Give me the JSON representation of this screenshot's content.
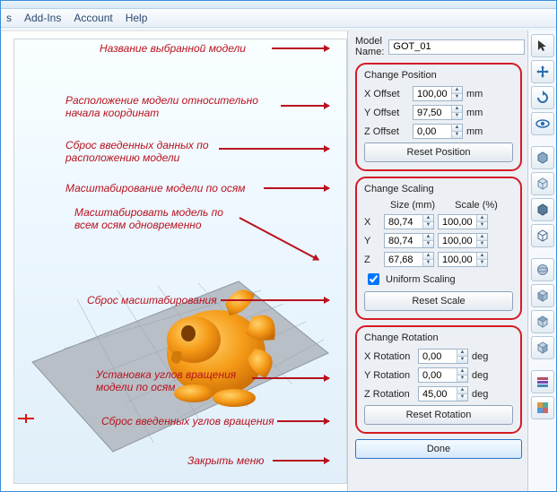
{
  "menu": {
    "items": [
      "Add-Ins",
      "Account",
      "Help"
    ],
    "prefix": "s"
  },
  "model_name": {
    "label": "Model Name:",
    "value": "GOT_01"
  },
  "position": {
    "title": "Change Position",
    "x": {
      "label": "X Offset",
      "value": "100,00",
      "unit": "mm"
    },
    "y": {
      "label": "Y Offset",
      "value": "97,50",
      "unit": "mm"
    },
    "z": {
      "label": "Z Offset",
      "value": "0,00",
      "unit": "mm"
    },
    "reset": "Reset Position"
  },
  "scaling": {
    "title": "Change Scaling",
    "size_hdr": "Size (mm)",
    "scale_hdr": "Scale (%)",
    "x": {
      "ax": "X",
      "size": "80,74",
      "scale": "100,00"
    },
    "y": {
      "ax": "Y",
      "size": "80,74",
      "scale": "100,00"
    },
    "z": {
      "ax": "Z",
      "size": "67,68",
      "scale": "100,00"
    },
    "uniform": {
      "checked": true,
      "label": "Uniform Scaling"
    },
    "reset": "Reset Scale"
  },
  "rotation": {
    "title": "Change Rotation",
    "x": {
      "label": "X Rotation",
      "value": "0,00",
      "unit": "deg"
    },
    "y": {
      "label": "Y Rotation",
      "value": "0,00",
      "unit": "deg"
    },
    "z": {
      "label": "Z Rotation",
      "value": "45,00",
      "unit": "deg"
    },
    "reset": "Reset Rotation"
  },
  "done": "Done",
  "annotations": {
    "a1": "Название выбранной модели",
    "a2a": "Расположение модели относительно",
    "a2b": "начала координат",
    "a3a": "Сброс введенных данных по",
    "a3b": "расположению модели",
    "a4": "Масштабирование модели по осям",
    "a5a": "Масштабировать модель по",
    "a5b": "всем осям одновременно",
    "a6": "Сброс масштабирования",
    "a7a": "Установка углов вращения",
    "a7b": "модели по осям",
    "a8": "Сброс введенных углов вращения",
    "a9": "Закрыть меню"
  },
  "toolbar_icons": [
    "cursor",
    "move",
    "rotate",
    "eye",
    "cube-solid",
    "cube-outline",
    "cube-dark",
    "cube-wire",
    "sphere",
    "iso-front",
    "iso-top",
    "iso-side",
    "layers",
    "color"
  ]
}
